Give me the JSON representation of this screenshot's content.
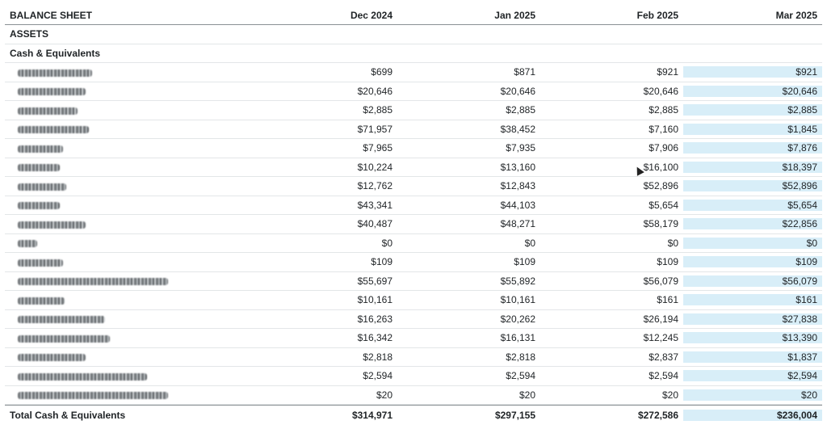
{
  "header": {
    "title": "BALANCE SHEET",
    "columns": [
      "Dec 2024",
      "Jan 2025",
      "Feb 2025",
      "Mar 2025"
    ]
  },
  "assets_label": "ASSETS",
  "group_label": "Cash & Equivalents",
  "rows": [
    {
      "name": "",
      "values": [
        "$699",
        "$871",
        "$921",
        "$921"
      ]
    },
    {
      "name": "",
      "values": [
        "$20,646",
        "$20,646",
        "$20,646",
        "$20,646"
      ]
    },
    {
      "name": "",
      "values": [
        "$2,885",
        "$2,885",
        "$2,885",
        "$2,885"
      ]
    },
    {
      "name": "",
      "values": [
        "$71,957",
        "$38,452",
        "$7,160",
        "$1,845"
      ]
    },
    {
      "name": "",
      "values": [
        "$7,965",
        "$7,935",
        "$7,906",
        "$7,876"
      ]
    },
    {
      "name": "",
      "values": [
        "$10,224",
        "$13,160",
        "$16,100",
        "$18,397"
      ]
    },
    {
      "name": "",
      "values": [
        "$12,762",
        "$12,843",
        "$52,896",
        "$52,896"
      ]
    },
    {
      "name": "",
      "values": [
        "$43,341",
        "$44,103",
        "$5,654",
        "$5,654"
      ]
    },
    {
      "name": "",
      "values": [
        "$40,487",
        "$48,271",
        "$58,179",
        "$22,856"
      ]
    },
    {
      "name": "",
      "values": [
        "$0",
        "$0",
        "$0",
        "$0"
      ]
    },
    {
      "name": "",
      "values": [
        "$109",
        "$109",
        "$109",
        "$109"
      ]
    },
    {
      "name": "",
      "values": [
        "$55,697",
        "$55,892",
        "$56,079",
        "$56,079"
      ]
    },
    {
      "name": "",
      "values": [
        "$10,161",
        "$10,161",
        "$161",
        "$161"
      ]
    },
    {
      "name": "",
      "values": [
        "$16,263",
        "$20,262",
        "$26,194",
        "$27,838"
      ]
    },
    {
      "name": "",
      "values": [
        "$16,342",
        "$16,131",
        "$12,245",
        "$13,390"
      ]
    },
    {
      "name": "",
      "values": [
        "$2,818",
        "$2,818",
        "$2,837",
        "$1,837"
      ]
    },
    {
      "name": "",
      "values": [
        "$2,594",
        "$2,594",
        "$2,594",
        "$2,594"
      ]
    },
    {
      "name": "",
      "values": [
        "$20",
        "$20",
        "$20",
        "$20"
      ]
    }
  ],
  "total": {
    "label": "Total Cash & Equivalents",
    "values": [
      "$314,971",
      "$297,155",
      "$272,586",
      "$236,004"
    ]
  },
  "colors": {
    "highlight_column": "#d8eef8",
    "divider": "#8a9094",
    "row_border": "#e3e6e8"
  },
  "icons": {
    "cursor": "mouse-pointer-icon"
  }
}
